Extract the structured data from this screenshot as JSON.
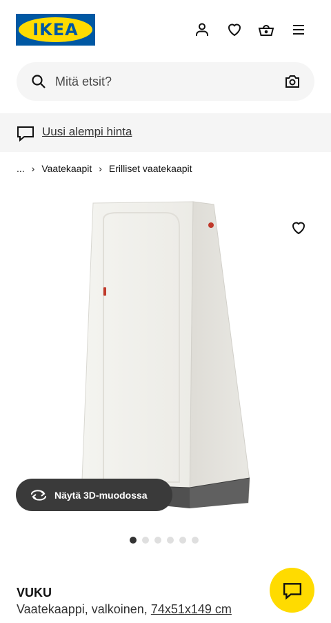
{
  "header": {
    "logo_text": "IKEA",
    "icons": [
      "account-icon",
      "heart-icon",
      "basket-icon",
      "menu-icon"
    ]
  },
  "search": {
    "placeholder": "Mitä etsit?"
  },
  "promo": {
    "text": "Uusi alempi hinta"
  },
  "breadcrumb": {
    "items": [
      "...",
      "Vaatekaapit",
      "Erilliset vaatekaapit"
    ]
  },
  "gallery": {
    "view3d_label": "Näytä 3D-muodossa",
    "total_images": 6,
    "active_index": 0
  },
  "product": {
    "name": "VUKU",
    "description": "Vaatekaappi, valkoinen,",
    "size": "74x51x149 cm"
  },
  "colors": {
    "brand_blue": "#0058a3",
    "brand_yellow": "#ffdb00",
    "promo_bg": "#f5f5f5"
  }
}
